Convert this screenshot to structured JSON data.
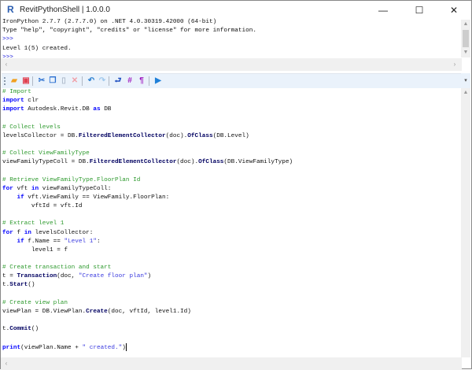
{
  "window": {
    "title": "RevitPythonShell | 1.0.0.0",
    "app_icon": "R",
    "minimize": "—",
    "maximize": "☐",
    "close": "✕"
  },
  "output": {
    "lines": [
      {
        "text": "IronPython 2.7.7 (2.7.7.0) on .NET 4.0.30319.42000 (64-bit)",
        "prompt": false
      },
      {
        "text": "Type \"help\", \"copyright\", \"credits\" or \"license\" for more information.",
        "prompt": false
      },
      {
        "text": ">>>",
        "prompt": true
      },
      {
        "text": "Level 1(5) created.",
        "prompt": false
      },
      {
        "text": ">>>",
        "prompt": true
      }
    ]
  },
  "toolbar": {
    "buttons": [
      {
        "name": "open-icon",
        "glyph": "▰",
        "color": "#f0a020"
      },
      {
        "name": "save-icon",
        "glyph": "▣",
        "color": "#e04050"
      },
      {
        "name": "cut-icon",
        "glyph": "✂",
        "color": "#2a6fd0"
      },
      {
        "name": "copy-icon",
        "glyph": "❐",
        "color": "#2a6fd0"
      },
      {
        "name": "paste-icon",
        "glyph": "▯",
        "color": "#b0bccc"
      },
      {
        "name": "delete-icon",
        "glyph": "✕",
        "color": "#f0a0a8"
      },
      {
        "name": "undo-icon",
        "glyph": "↶",
        "color": "#2a7fd0"
      },
      {
        "name": "redo-icon",
        "glyph": "↷",
        "color": "#a0c8ec"
      },
      {
        "name": "word-wrap-icon",
        "glyph": "⮐",
        "color": "#2050c0"
      },
      {
        "name": "line-numbers-icon",
        "glyph": "#",
        "color": "#a020c0"
      },
      {
        "name": "show-whitespace-icon",
        "glyph": "¶",
        "color": "#a020c0"
      },
      {
        "name": "run-icon",
        "glyph": "▶",
        "color": "#1e7fd8"
      }
    ]
  },
  "editor": {
    "lines": [
      [
        [
          "# Import",
          "cm"
        ]
      ],
      [
        [
          "import",
          "kw"
        ],
        [
          " clr",
          ""
        ]
      ],
      [
        [
          "import",
          "kw"
        ],
        [
          " Autodesk.Revit.DB ",
          ""
        ],
        [
          "as",
          "kw"
        ],
        [
          " DB",
          ""
        ]
      ],
      [],
      [
        [
          "# Collect levels",
          "cm"
        ]
      ],
      [
        [
          "levelsCollector = DB.",
          ""
        ],
        [
          "FilteredElementCollector",
          "fn"
        ],
        [
          "(doc).",
          ""
        ],
        [
          "OfClass",
          "fn"
        ],
        [
          "(DB.Level)",
          ""
        ]
      ],
      [],
      [
        [
          "# Collect ViewFamilyType",
          "cm"
        ]
      ],
      [
        [
          "viewFamilyTypeColl = DB.",
          ""
        ],
        [
          "FilteredElementCollector",
          "fn"
        ],
        [
          "(doc).",
          ""
        ],
        [
          "OfClass",
          "fn"
        ],
        [
          "(DB.ViewFamilyType)",
          ""
        ]
      ],
      [],
      [
        [
          "# Retrieve ViewFamilyType.FloorPlan Id",
          "cm"
        ]
      ],
      [
        [
          "for",
          "kw"
        ],
        [
          " vft ",
          ""
        ],
        [
          "in",
          "kw"
        ],
        [
          " viewFamilyTypeColl:",
          ""
        ]
      ],
      [
        [
          "    ",
          ""
        ],
        [
          "if",
          "kw"
        ],
        [
          " vft.ViewFamily == ViewFamily.FloorPlan:",
          ""
        ]
      ],
      [
        [
          "        vftId = vft.Id",
          ""
        ]
      ],
      [],
      [
        [
          "# Extract level 1",
          "cm"
        ]
      ],
      [
        [
          "for",
          "kw"
        ],
        [
          " f ",
          ""
        ],
        [
          "in",
          "kw"
        ],
        [
          " levelsCollector:",
          ""
        ]
      ],
      [
        [
          "    ",
          ""
        ],
        [
          "if",
          "kw"
        ],
        [
          " f.Name == ",
          ""
        ],
        [
          "\"Level 1\"",
          "st"
        ],
        [
          ":",
          ""
        ]
      ],
      [
        [
          "        level1 = f",
          ""
        ]
      ],
      [],
      [
        [
          "# Create transaction and start",
          "cm"
        ]
      ],
      [
        [
          "t = ",
          ""
        ],
        [
          "Transaction",
          "fn"
        ],
        [
          "(doc, ",
          ""
        ],
        [
          "\"Create floor plan\"",
          "st"
        ],
        [
          ")",
          ""
        ]
      ],
      [
        [
          "t.",
          ""
        ],
        [
          "Start",
          "fn"
        ],
        [
          "()",
          ""
        ]
      ],
      [],
      [
        [
          "# Create view plan",
          "cm"
        ]
      ],
      [
        [
          "viewPlan = DB.ViewPlan.",
          ""
        ],
        [
          "Create",
          "fn"
        ],
        [
          "(doc, vftId, level1.Id)",
          ""
        ]
      ],
      [],
      [
        [
          "t.",
          ""
        ],
        [
          "Commit",
          "fn"
        ],
        [
          "()",
          ""
        ]
      ],
      [],
      [
        [
          "print",
          "kw"
        ],
        [
          "(viewPlan.Name + ",
          ""
        ],
        [
          "\" created.\"",
          "st"
        ],
        [
          ")",
          ""
        ]
      ]
    ]
  }
}
